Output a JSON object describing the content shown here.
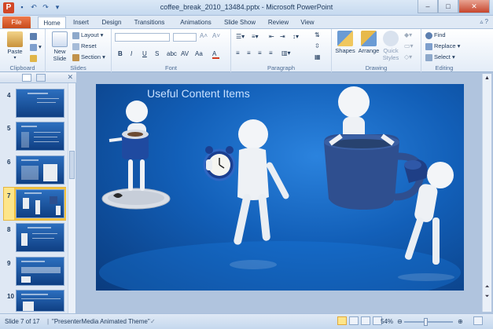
{
  "window": {
    "title": "coffee_break_2010_13484.pptx - Microsoft PowerPoint"
  },
  "tabs": [
    "File",
    "Home",
    "Insert",
    "Design",
    "Transitions",
    "Animations",
    "Slide Show",
    "Review",
    "View"
  ],
  "ribbon": {
    "clipboard": {
      "label": "Clipboard",
      "paste": "Paste"
    },
    "slides": {
      "label": "Slides",
      "new_slide": "New Slide",
      "layout": "Layout",
      "reset": "Reset",
      "section": "Section"
    },
    "font": {
      "label": "Font",
      "bold": "B",
      "italic": "I",
      "underline": "U",
      "strike": "S",
      "shadow": "abc",
      "spacing": "AV",
      "case": "Aa",
      "color": "A"
    },
    "paragraph": {
      "label": "Paragraph"
    },
    "drawing": {
      "label": "Drawing",
      "shapes": "Shapes",
      "arrange": "Arrange",
      "quick_styles": "Quick Styles"
    },
    "editing": {
      "label": "Editing",
      "find": "Find",
      "replace": "Replace",
      "select": "Select"
    }
  },
  "slide_thumbnails": [
    "4",
    "5",
    "6",
    "7",
    "8",
    "9",
    "10"
  ],
  "selected_slide": "7",
  "slide": {
    "title": "Useful Content Items"
  },
  "status": {
    "slide_info": "Slide 7 of 17",
    "theme": "\"PresenterMedia Animated Theme\"",
    "zoom": "54%"
  },
  "colors": {
    "accent": "#d24726",
    "ribbon": "#dfe9f5",
    "slide_bg": "#125fb8"
  }
}
